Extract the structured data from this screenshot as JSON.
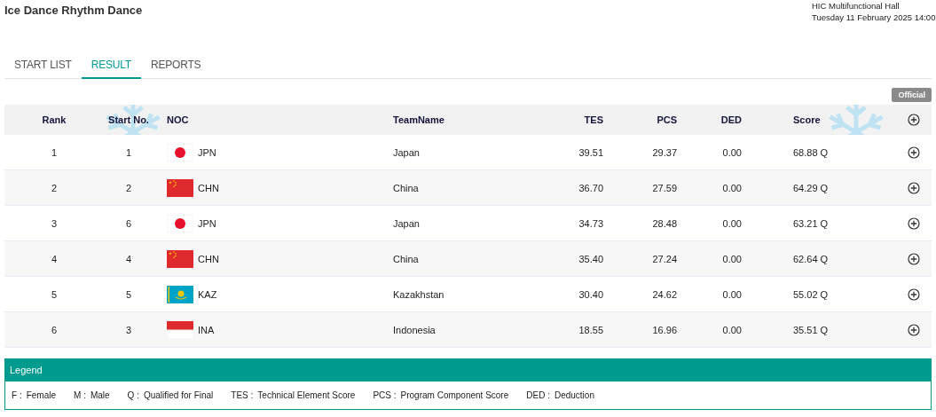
{
  "event": {
    "title": "Ice Dance Rhythm Dance",
    "venue": "HIC Multifunctional Hall",
    "datetime": "Tuesday 11 February 2025 14:00"
  },
  "tabs": [
    {
      "label": "START LIST",
      "selected": false
    },
    {
      "label": "RESULT",
      "selected": true
    },
    {
      "label": "REPORTS",
      "selected": false
    }
  ],
  "status_badge": "Official",
  "table": {
    "columns": [
      "Rank",
      "Start No.",
      "NOC",
      "TeamName",
      "TES",
      "PCS",
      "DED",
      "Score"
    ],
    "rows": [
      {
        "rank": "1",
        "start_no": "1",
        "kind": "japan",
        "noc": "JPN",
        "team": "Japan",
        "tes": "39.51",
        "pcs": "29.37",
        "ded": "0.00",
        "score": "68.88 Q"
      },
      {
        "rank": "2",
        "start_no": "2",
        "kind": "china",
        "noc": "CHN",
        "team": "China",
        "tes": "36.70",
        "pcs": "27.59",
        "ded": "0.00",
        "score": "64.29 Q"
      },
      {
        "rank": "3",
        "start_no": "6",
        "kind": "japan",
        "noc": "JPN",
        "team": "Japan",
        "tes": "34.73",
        "pcs": "28.48",
        "ded": "0.00",
        "score": "63.21 Q"
      },
      {
        "rank": "4",
        "start_no": "4",
        "kind": "china",
        "noc": "CHN",
        "team": "China",
        "tes": "35.40",
        "pcs": "27.24",
        "ded": "0.00",
        "score": "62.64 Q"
      },
      {
        "rank": "5",
        "start_no": "5",
        "kind": "kazakhstan",
        "noc": "KAZ",
        "team": "Kazakhstan",
        "tes": "30.40",
        "pcs": "24.62",
        "ded": "0.00",
        "score": "55.02 Q"
      },
      {
        "rank": "6",
        "start_no": "3",
        "kind": "indonesia",
        "noc": "INA",
        "team": "Indonesia",
        "tes": "18.55",
        "pcs": "16.96",
        "ded": "0.00",
        "score": "35.51 Q"
      }
    ]
  },
  "legend": {
    "title": "Legend",
    "items": [
      {
        "abbr": "F :",
        "meaning": "Female"
      },
      {
        "abbr": "M :",
        "meaning": "Male"
      },
      {
        "abbr": "Q :",
        "meaning": "Qualified for Final"
      },
      {
        "abbr": "TES :",
        "meaning": "Technical Element Score"
      },
      {
        "abbr": "PCS :",
        "meaning": "Program Component Score"
      },
      {
        "abbr": "DED :",
        "meaning": "Deduction"
      }
    ]
  }
}
